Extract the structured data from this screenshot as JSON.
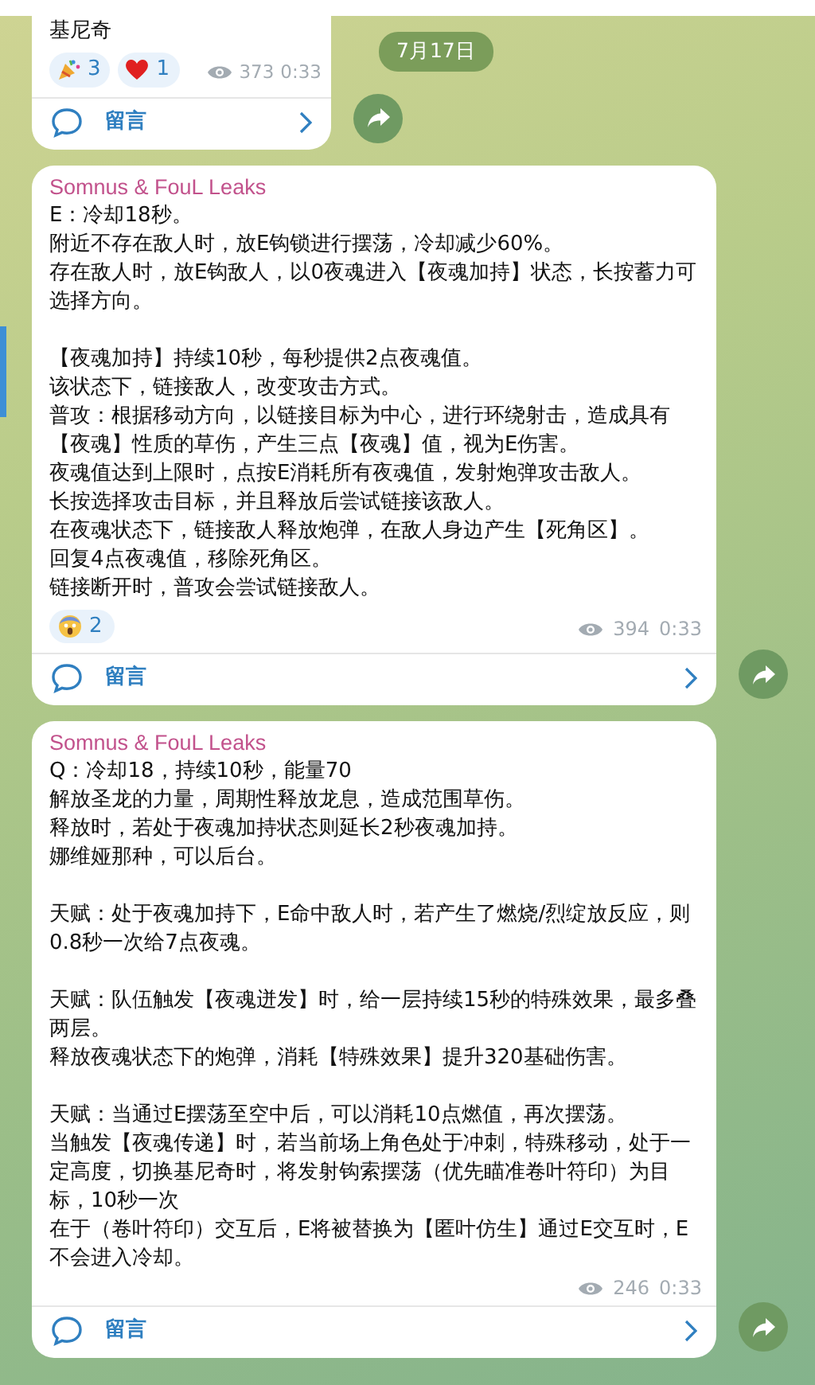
{
  "date_badge": "7月17日",
  "messages": [
    {
      "cut_top": true,
      "paragraphs": [
        [
          "基尼奇"
        ]
      ],
      "reactions": [
        {
          "kind": "party",
          "count": "3"
        },
        {
          "kind": "heart",
          "count": "1"
        }
      ],
      "views": "373",
      "time": "0:33",
      "comment_label": "留言"
    },
    {
      "author": "Somnus & FouL Leaks",
      "paragraphs": [
        [
          "E：冷却18秒。",
          "附近不存在敌人时，放E钩锁进行摆荡，冷却减少60%。",
          "存在敌人时，放E钩敌人，以0夜魂进入【夜魂加持】状态，长按蓄力可选择方向。"
        ],
        [
          "【夜魂加持】持续10秒，每秒提供2点夜魂值。",
          "该状态下，链接敌人，改变攻击方式。",
          "普攻：根据移动方向，以链接目标为中心，进行环绕射击，造成具有【夜魂】性质的草伤，产生三点【夜魂】值，视为E伤害。",
          "夜魂值达到上限时，点按E消耗所有夜魂值，发射炮弹攻击敌人。",
          "长按选择攻击目标，并且释放后尝试链接该敌人。",
          "在夜魂状态下，链接敌人释放炮弹，在敌人身边产生【死角区】。",
          "回复4点夜魂值，移除死角区。",
          "链接断开时，普攻会尝试链接敌人。"
        ]
      ],
      "reactions": [
        {
          "kind": "scream",
          "count": "2"
        }
      ],
      "views": "394",
      "time": "0:33",
      "comment_label": "留言"
    },
    {
      "author": "Somnus & FouL Leaks",
      "paragraphs": [
        [
          "Q：冷却18，持续10秒，能量70",
          "解放圣龙的力量，周期性释放龙息，造成范围草伤。",
          "释放时，若处于夜魂加持状态则延长2秒夜魂加持。",
          "娜维娅那种，可以后台。"
        ],
        [
          "天赋：处于夜魂加持下，E命中敌人时，若产生了燃烧/烈绽放反应，则0.8秒一次给7点夜魂。"
        ],
        [
          "天赋：队伍触发【夜魂迸发】时，给一层持续15秒的特殊效果，最多叠两层。",
          "释放夜魂状态下的炮弹，消耗【特殊效果】提升320基础伤害。"
        ],
        [
          "天赋：当通过E摆荡至空中后，可以消耗10点燃值，再次摆荡。",
          "当触发【夜魂传递】时，若当前场上角色处于冲刺，特殊移动，处于一定高度，切换基尼奇时，将发射钩索摆荡（优先瞄准卷叶符印）为目标，10秒一次",
          "在于（卷叶符印）交互后，E将被替换为【匿叶仿生】通过E交互时，E不会进入冷却。"
        ]
      ],
      "views": "246",
      "time": "0:33",
      "comment_label": "留言"
    }
  ]
}
